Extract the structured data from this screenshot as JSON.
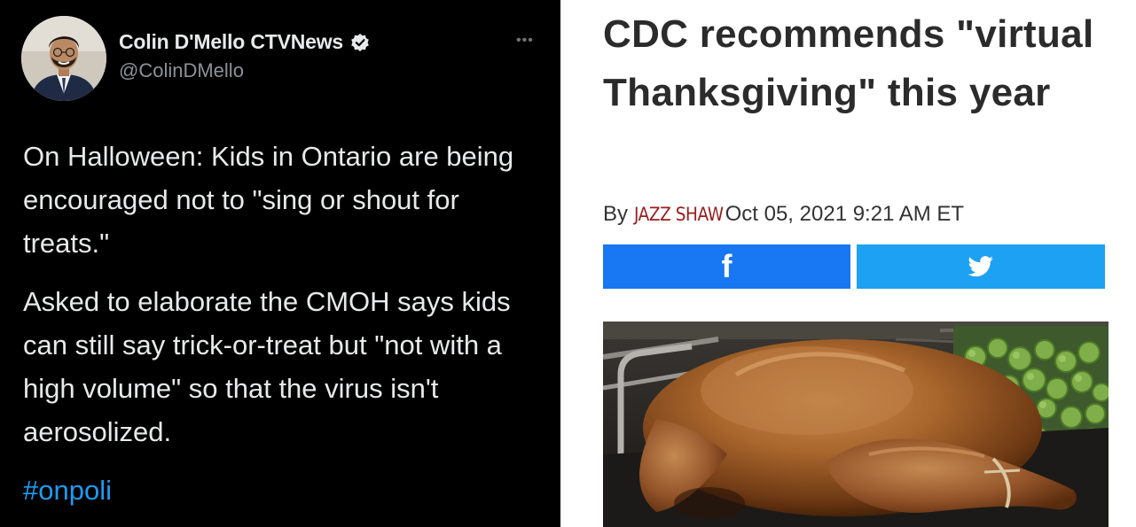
{
  "tweet": {
    "author_name": "Colin D'Mello CTVNews",
    "handle": "@ColinDMello",
    "paragraph_1": "On Halloween: Kids in Ontario are being encouraged not to \"sing or shout for treats.\"",
    "paragraph_2": "Asked to elaborate the CMOH says kids can still say trick-or-treat but \"not with a high volume\" so that the virus isn't aerosolized.",
    "hashtag": "#onpoli",
    "icons": {
      "avatar": "profile-photo",
      "verified": "verified-badge-icon",
      "more": "more-options-icon"
    },
    "colors": {
      "background": "#000000",
      "text": "#e7e9ea",
      "handle": "#8b9299",
      "link": "#1d9bf0",
      "verified": "#1d9bf0"
    }
  },
  "article": {
    "headline": "CDC recommends \"virtual Thanksgiving\" this year",
    "byline_prefix": "By",
    "author": "JAZZ SHAW",
    "date": "Oct 05, 2021 9:21 AM ET",
    "share": {
      "facebook_glyph": "f",
      "facebook_icon": "facebook-icon",
      "twitter_icon": "twitter-bird-icon"
    },
    "image": "roast-turkey-photo",
    "colors": {
      "headline": "#2b2b2b",
      "author": "#9b1c1c",
      "facebook": "#1877f2",
      "twitter": "#1da1f2"
    }
  }
}
